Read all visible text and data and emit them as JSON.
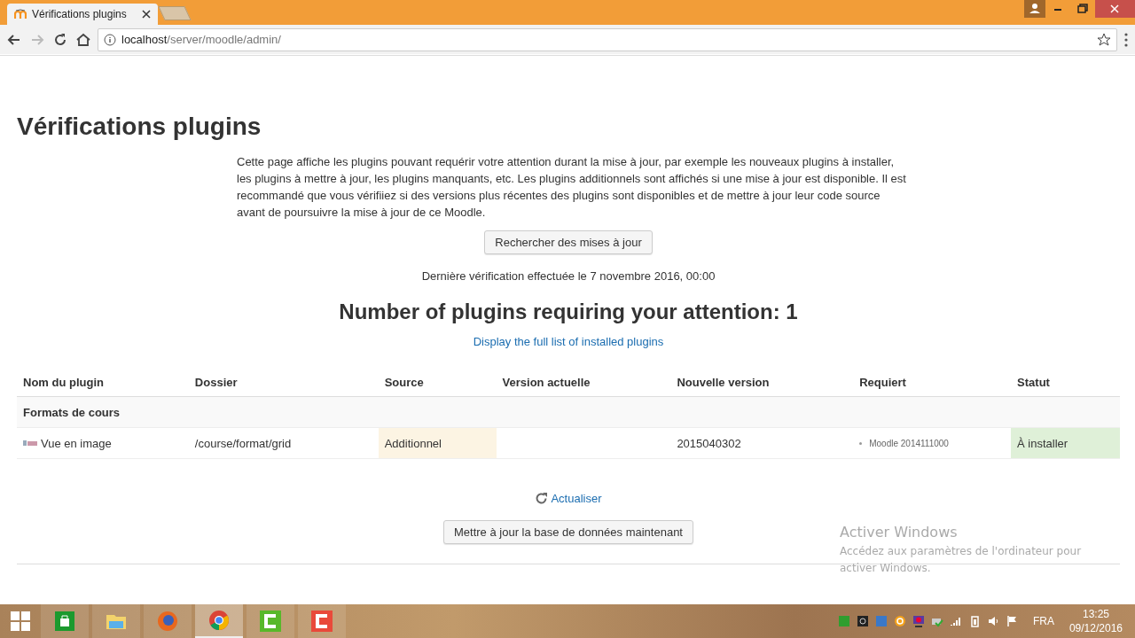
{
  "browser": {
    "tabs": [
      {
        "title": "Vérifications plugins",
        "selected": true
      }
    ],
    "url": {
      "host": "localhost",
      "path": "/server/moodle/admin/"
    }
  },
  "page": {
    "title": "Vérifications plugins",
    "intro": "Cette page affiche les plugins pouvant requérir votre attention durant la mise à jour, par exemple les nouveaux plugins à installer, les plugins à mettre à jour, les plugins manquants, etc. Les plugins additionnels sont affichés si une mise à jour est disponible. Il est recommandé que vous vérifiiez si des versions plus récentes des plugins sont disponibles et de mettre à jour leur code source avant de poursuivre la mise à jour de ce Moodle.",
    "check_button": "Rechercher des mises à jour",
    "last_check": "Dernière vérification effectuée le 7 novembre 2016, 00:00",
    "attention_heading": "Number of plugins requiring your attention: 1",
    "full_list_link": "Display the full list of installed plugins",
    "table": {
      "columns": [
        "Nom du plugin",
        "Dossier",
        "Source",
        "Version actuelle",
        "Nouvelle version",
        "Requiert",
        "Statut"
      ],
      "groups": [
        {
          "name": "Formats de cours",
          "rows": [
            {
              "name": "Vue en image",
              "folder": "/course/format/grid",
              "source": "Additionnel",
              "additional": true,
              "new_version": "2015040302",
              "requires": [
                "Moodle 2014111000"
              ],
              "status": "À installer",
              "kind": "install"
            }
          ]
        }
      ]
    },
    "refresh_link": "Actualiser",
    "upgrade_button": "Mettre à jour la base de données maintenant"
  },
  "watermark": {
    "title": "Activer Windows",
    "text": "Accédez aux paramètres de l'ordinateur pour activer Windows."
  },
  "taskbar": {
    "apps": [
      {
        "kind": "store",
        "selected": false
      },
      {
        "kind": "explorer",
        "selected": false
      },
      {
        "kind": "firefox",
        "selected": false
      },
      {
        "kind": "chrome",
        "selected": true
      },
      {
        "kind": "camtasia-green",
        "selected": false
      },
      {
        "kind": "camtasia-red",
        "selected": false
      }
    ],
    "language": "FRA",
    "time": "13:25",
    "date": "09/12/2016"
  }
}
